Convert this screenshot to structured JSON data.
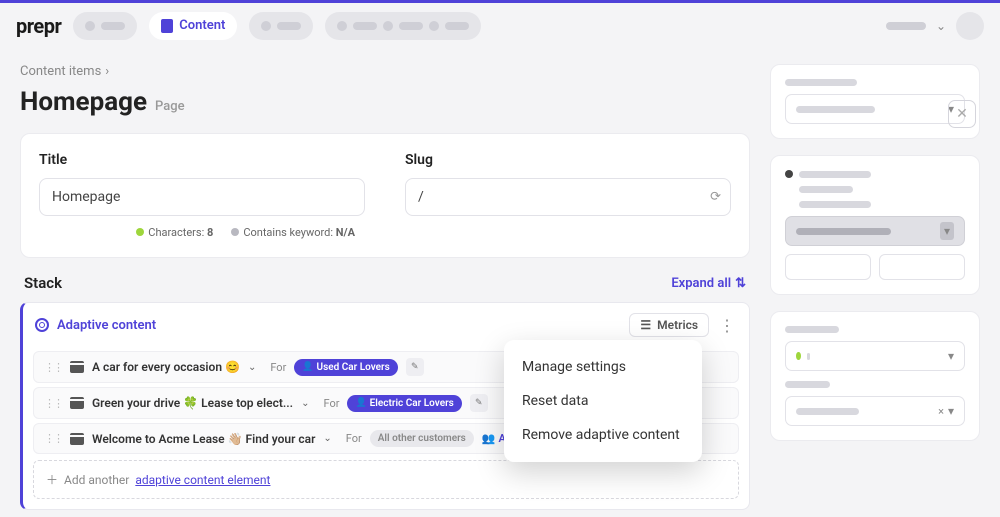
{
  "brand": "prepr",
  "nav": {
    "active_tab": "Content"
  },
  "breadcrumb": "Content items",
  "page": {
    "title": "Homepage",
    "type": "Page"
  },
  "fields": {
    "title_label": "Title",
    "title_value": "Homepage",
    "slug_label": "Slug",
    "slug_value": "/",
    "characters_label": "Characters:",
    "characters_value": "8",
    "keyword_label": "Contains keyword:",
    "keyword_value": "N/A"
  },
  "stack": {
    "title": "Stack",
    "expand_all": "Expand all",
    "adaptive_label": "Adaptive content",
    "metrics_label": "Metrics",
    "for_label": "For",
    "variants": [
      {
        "title": "A car for every occasion 😊",
        "segment": "Used Car Lovers",
        "segment_style": "primary",
        "editable": true
      },
      {
        "title": "Green your drive 🍀 Lease top elect...",
        "segment": "Electric Car Lovers",
        "segment_style": "primary",
        "editable": true
      },
      {
        "title": "Welcome to Acme Lease 👋🏼 Find your car",
        "segment": "All other customers",
        "segment_style": "grey",
        "add_segment": true
      }
    ],
    "add_segment_label": "Add segm",
    "add_another_prefix": "Add another ",
    "add_another_link": "adaptive content element"
  },
  "menu": {
    "items": [
      "Manage settings",
      "Reset data",
      "Remove adaptive content"
    ]
  }
}
